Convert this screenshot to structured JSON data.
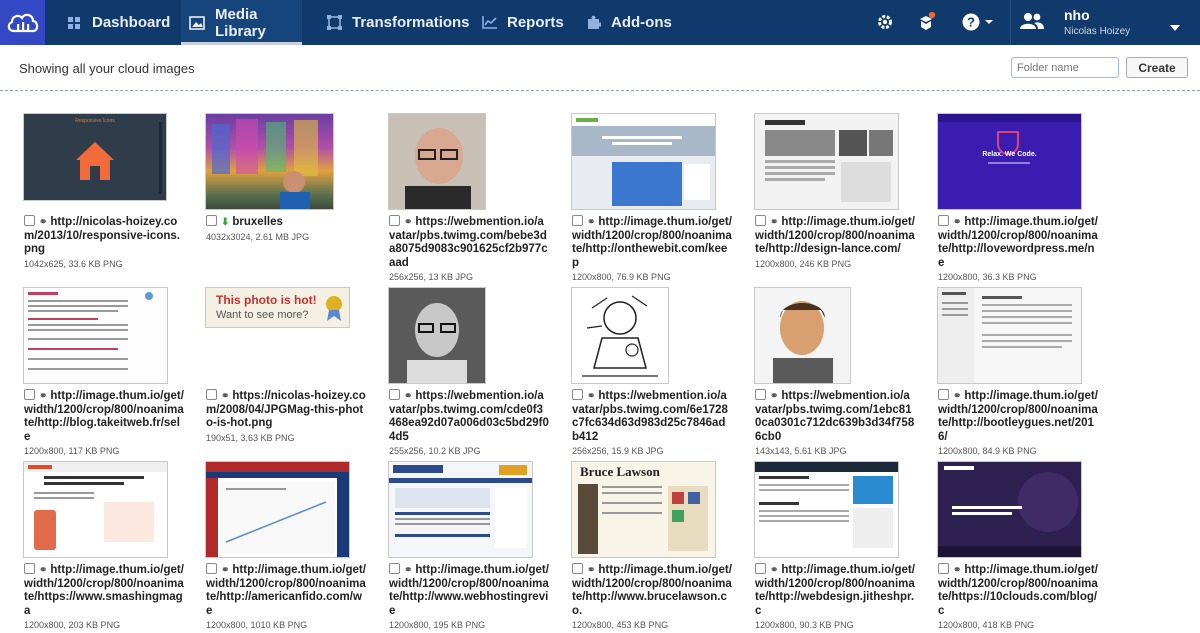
{
  "nav": {
    "items": [
      {
        "label": "Dashboard",
        "icon": "dashboard-icon"
      },
      {
        "label": "Media Library",
        "icon": "media-library-icon"
      },
      {
        "label": "Transformations",
        "icon": "transformations-icon"
      },
      {
        "label": "Reports",
        "icon": "reports-icon"
      },
      {
        "label": "Add-ons",
        "icon": "addons-icon"
      }
    ],
    "user": {
      "name": "nho",
      "full_name": "Nicolas Hoizey"
    },
    "accent": "#0f3a6b",
    "logo_bg": "#3448c5",
    "notification_dot": "#f26b2d"
  },
  "toolbar": {
    "heading": "Showing all your cloud images",
    "folder_placeholder": "Folder name",
    "create_label": "Create"
  },
  "assets": [
    {
      "title": "http://nicolas-hoizey.com/2013/10/responsive-icons.png",
      "meta": "1042x625, 33.6 KB PNG",
      "kind": "link"
    },
    {
      "title": "bruxelles",
      "meta": "4032x3024, 2.61 MB JPG",
      "kind": "upload"
    },
    {
      "title": "https://webmention.io/avatar/pbs.twimg.com/bebe3da8075d9083c901625cf2b977caad",
      "meta": "256x256, 13 KB JPG",
      "kind": "link"
    },
    {
      "title": "http://image.thum.io/get/width/1200/crop/800/noanimate/http://onthewebit.com/keep",
      "meta": "1200x800, 76.9 KB PNG",
      "kind": "link"
    },
    {
      "title": "http://image.thum.io/get/width/1200/crop/800/noanimate/http://design-lance.com/",
      "meta": "1200x800, 246 KB PNG",
      "kind": "link"
    },
    {
      "title": "http://image.thum.io/get/width/1200/crop/800/noanimate/http://lovewordpress.me/ne",
      "meta": "1200x800, 36.3 KB PNG",
      "kind": "link"
    },
    {
      "title": "http://image.thum.io/get/width/1200/crop/800/noanimate/http://blog.takeitweb.fr/sele",
      "meta": "1200x800, 117 KB PNG",
      "kind": "link"
    },
    {
      "title": "https://nicolas-hoizey.com/2008/04/JPGMag-this-photo-is-hot.png",
      "meta": "190x51, 3.63 KB PNG",
      "kind": "link"
    },
    {
      "title": "https://webmention.io/avatar/pbs.twimg.com/cde0f3468ea92d07a006d03c5bd29f04d5",
      "meta": "255x256, 10.2 KB JPG",
      "kind": "link"
    },
    {
      "title": "https://webmention.io/avatar/pbs.twimg.com/6e1728c7fc634d63d983d25c7846adb412",
      "meta": "256x256, 15.9 KB JPG",
      "kind": "link"
    },
    {
      "title": "https://webmention.io/avatar/pbs.twimg.com/1ebc810ca0301c712dc639b3d34f7586cb0",
      "meta": "143x143, 5.61 KB JPG",
      "kind": "link"
    },
    {
      "title": "http://image.thum.io/get/width/1200/crop/800/noanimate/http://bootleygues.net/2016/",
      "meta": "1200x800, 84.9 KB PNG",
      "kind": "link"
    },
    {
      "title": "http://image.thum.io/get/width/1200/crop/800/noanimate/https://www.smashingmaga",
      "meta": "1200x800, 203 KB PNG",
      "kind": "link"
    },
    {
      "title": "http://image.thum.io/get/width/1200/crop/800/noanimate/http://americanfido.com/we",
      "meta": "1200x800, 1010 KB PNG",
      "kind": "link"
    },
    {
      "title": "http://image.thum.io/get/width/1200/crop/800/noanimate/http://www.webhostingrevie",
      "meta": "1200x800, 195 KB PNG",
      "kind": "link"
    },
    {
      "title": "http://image.thum.io/get/width/1200/crop/800/noanimate/http://www.brucelawson.co.",
      "meta": "1200x800, 453 KB PNG",
      "kind": "link"
    },
    {
      "title": "http://image.thum.io/get/width/1200/crop/800/noanimate/http://webdesign.jitheshpr.c",
      "meta": "1200x800, 90.3 KB PNG",
      "kind": "link"
    },
    {
      "title": "http://image.thum.io/get/width/1200/crop/800/noanimate/https://10clouds.com/blog/c",
      "meta": "1200x800, 418 KB PNG",
      "kind": "link"
    }
  ],
  "thumb_text": {
    "t1": "Responsive Icons",
    "t6a": "Relax. We Code.",
    "t8a": "This photo is hot!",
    "t8b": "Want to see more?",
    "t16": "Bruce Lawson"
  }
}
